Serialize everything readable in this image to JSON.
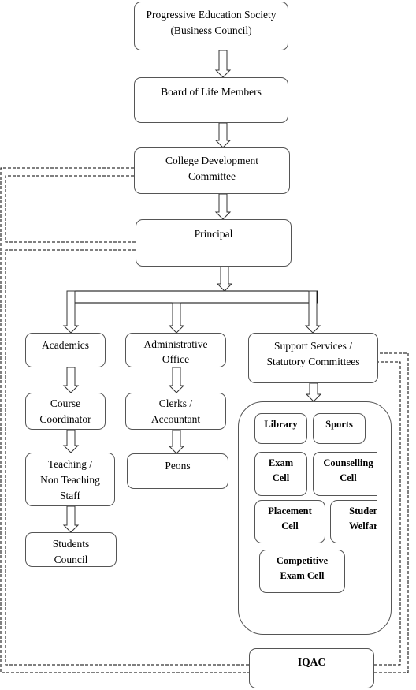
{
  "nodes": {
    "pes": {
      "line1": "Progressive Education Society",
      "line2": "(Business Council)"
    },
    "board": {
      "line1": "Board of Life Members"
    },
    "cdc": {
      "line1": "College Development",
      "line2": "Committee"
    },
    "principal": {
      "line1": "Principal"
    },
    "academics": {
      "line1": "Academics"
    },
    "admin": {
      "line1": "Administrative",
      "line2": "Office"
    },
    "support": {
      "line1": "Support Services /",
      "line2": "Statutory Committees"
    },
    "course": {
      "line1": "Course",
      "line2": "Coordinator"
    },
    "teaching": {
      "line1": "Teaching /",
      "line2": "Non Teaching",
      "line3": "Staff"
    },
    "students": {
      "line1": "Students",
      "line2": "Council"
    },
    "clerks": {
      "line1": "Clerks /",
      "line2": "Accountant"
    },
    "peons": {
      "line1": "Peons"
    },
    "library": {
      "line1": "Library"
    },
    "sports": {
      "line1": "Sports"
    },
    "exam": {
      "line1": "Exam",
      "line2": "Cell"
    },
    "counselling": {
      "line1": "Counselling",
      "line2": "Cell"
    },
    "placement": {
      "line1": "Placement",
      "line2": "Cell"
    },
    "welfare": {
      "line1": "Student",
      "line2": "Welfare"
    },
    "competitive": {
      "line1": "Competitive",
      "line2": "Exam Cell"
    },
    "iqac": {
      "line1": "IQAC"
    }
  }
}
